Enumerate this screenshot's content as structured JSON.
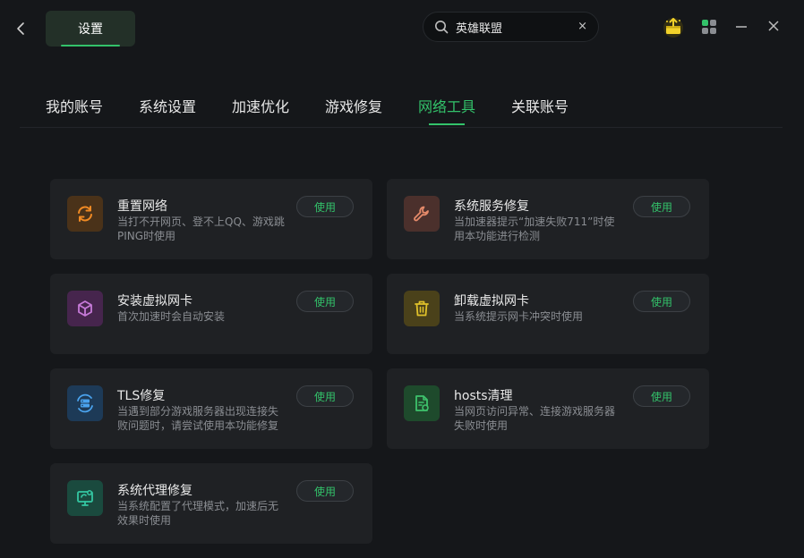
{
  "topbar": {
    "settings_label": "设置",
    "search_value": "英雄联盟",
    "clear_glyph": "×",
    "icons": [
      "back-arrow-icon",
      "gift-box-icon",
      "apps-grid-icon",
      "minimize-icon",
      "close-icon"
    ],
    "accent": "#33c26a"
  },
  "tabs": [
    {
      "label": "我的账号"
    },
    {
      "label": "系统设置"
    },
    {
      "label": "加速优化"
    },
    {
      "label": "游戏修复"
    },
    {
      "label": "网络工具",
      "active": true
    },
    {
      "label": "关联账号"
    }
  ],
  "tools": [
    {
      "title": "重置网络",
      "desc": "当打不开网页、登不上QQ、游戏跳PING时使用",
      "button": "使用",
      "icon": "refresh-icon",
      "color": "#f08a24"
    },
    {
      "title": "系统服务修复",
      "desc": "当加速器提示“加速失败711”时使用本功能进行检测",
      "button": "使用",
      "icon": "wrench-icon",
      "color": "#e58a6a"
    },
    {
      "title": "安装虚拟网卡",
      "desc": "首次加速时会自动安装",
      "button": "使用",
      "icon": "cube-icon",
      "color": "#c67ad8"
    },
    {
      "title": "卸载虚拟网卡",
      "desc": "当系统提示网卡冲突时使用",
      "button": "使用",
      "icon": "trash-icon",
      "color": "#e0c12a"
    },
    {
      "title": "TLS修复",
      "desc": "当遇到部分游戏服务器出现连接失败问题时，请尝试使用本功能修复",
      "button": "使用",
      "icon": "server-repair-icon",
      "color": "#4aa3ee"
    },
    {
      "title": "hosts清理",
      "desc": "当网页访问异常、连接游戏服务器失败时使用",
      "button": "使用",
      "icon": "file-clean-icon",
      "color": "#3ec26c"
    },
    {
      "title": "系统代理修复",
      "desc": "当系统配置了代理模式，加速后无效果时使用",
      "button": "使用",
      "icon": "monitor-proxy-icon",
      "color": "#34c7a2"
    }
  ]
}
